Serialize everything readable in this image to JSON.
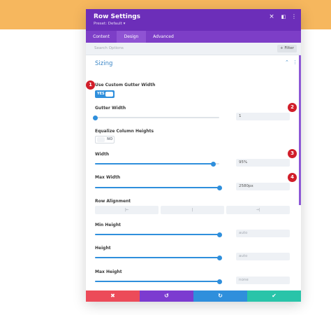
{
  "header": {
    "title": "Row Settings",
    "preset": "Preset: Default ▾",
    "close_icon": "×",
    "expand_icon": "◧",
    "more_icon": "⋮"
  },
  "tabs": [
    {
      "label": "Content",
      "active": false
    },
    {
      "label": "Design",
      "active": true
    },
    {
      "label": "Advanced",
      "active": false
    }
  ],
  "search": {
    "placeholder": "Search Options",
    "filter_label": "+ Filter"
  },
  "section": {
    "title": "Sizing",
    "collapse_icon": "⌃",
    "more_icon": "⋮"
  },
  "fields": {
    "custom_gutter": {
      "label": "Use Custom Gutter Width",
      "state": "YES"
    },
    "gutter_width": {
      "label": "Gutter Width",
      "value": "1",
      "slider_fraction": 0.0
    },
    "equalize": {
      "label": "Equalize Column Heights",
      "state": "NO"
    },
    "width": {
      "label": "Width",
      "value": "95%",
      "slider_fraction": 0.95
    },
    "max_width": {
      "label": "Max Width",
      "value": "2580px",
      "slider_fraction": 1.0
    },
    "row_alignment": {
      "label": "Row Alignment",
      "options": [
        "|←",
        "|",
        "→|"
      ]
    },
    "min_height": {
      "label": "Min Height",
      "placeholder": "auto",
      "slider_fraction": 1.0
    },
    "height": {
      "label": "Height",
      "placeholder": "auto",
      "slider_fraction": 1.0
    },
    "max_height": {
      "label": "Max Height",
      "placeholder": "none",
      "slider_fraction": 1.0
    }
  },
  "footer": {
    "cancel_icon": "✖",
    "undo_icon": "↺",
    "redo_icon": "↻",
    "save_icon": "✔"
  },
  "badges": [
    "1",
    "2",
    "3",
    "4"
  ],
  "colors": {
    "header": "#6c2eb9",
    "accent": "#2f8fdc",
    "cancel": "#ec4b59",
    "undo": "#7c3bd0",
    "redo": "#2f8fdc",
    "save": "#29c4a9",
    "badge": "#d11e2a"
  }
}
